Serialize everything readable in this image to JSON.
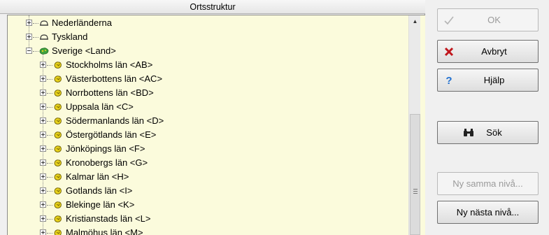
{
  "panel": {
    "title": "Ortsstruktur"
  },
  "tree": {
    "top_nodes": [
      {
        "label": "Nederländerna",
        "expanded": false
      },
      {
        "label": "Tyskland",
        "expanded": false
      },
      {
        "label": "Sverige <Land>",
        "expanded": true
      }
    ],
    "children": [
      "Stockholms län <AB>",
      "Västerbottens län <AC>",
      "Norrbottens län <BD>",
      "Uppsala län <C>",
      "Södermanlands län <D>",
      "Östergötlands län <E>",
      "Jönköpings län <F>",
      "Kronobergs län <G>",
      "Kalmar län <H>",
      "Gotlands län <I>",
      "Blekinge län <K>",
      "Kristianstads län <L>",
      "Malmöhus län <M>"
    ]
  },
  "buttons": {
    "ok": "OK",
    "cancel": "Avbryt",
    "help": "Hjälp",
    "search": "Sök",
    "new_same_level": "Ny samma nivå...",
    "new_next_level": "Ny nästa nivå..."
  },
  "colors": {
    "tree_background": "#fbfbdc",
    "country_icon": "#555555",
    "land_icon": "#3fa33f",
    "county_icon": "#e8d21c",
    "cancel_icon": "#c0161c",
    "help_icon": "#1f6fd0"
  },
  "icons": {
    "country": "country-outline-icon",
    "land": "sweden-map-icon",
    "county": "county-icon",
    "ok": "checkmark-icon",
    "cancel": "red-x-icon",
    "help": "question-mark-icon",
    "search": "binoculars-icon"
  }
}
